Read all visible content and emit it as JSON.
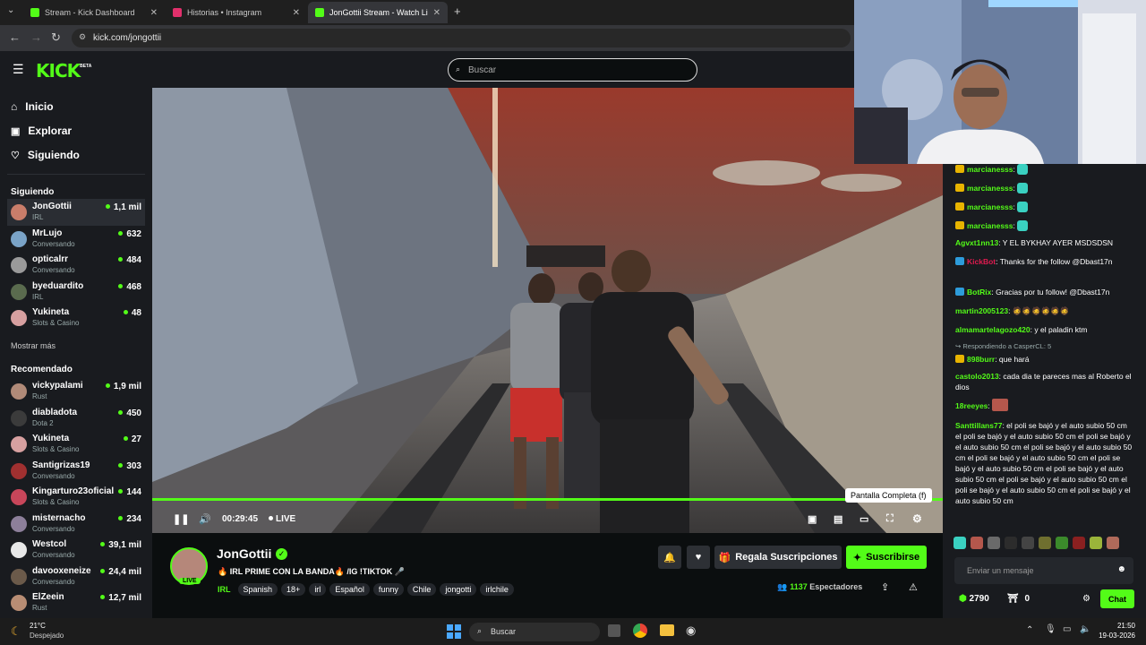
{
  "browser": {
    "tabs": [
      {
        "title": "Stream - Kick Dashboard",
        "color": "#53fc18"
      },
      {
        "title": "Historias • Instagram",
        "color": "#e1306c"
      },
      {
        "title": "JonGottii Stream - Watch Li",
        "color": "#53fc18"
      }
    ],
    "url": "kick.com/jongottii"
  },
  "header": {
    "logo": "KICK",
    "logo_badge": "BETA",
    "search_placeholder": "Buscar"
  },
  "sidebar": {
    "nav": [
      {
        "label": "Inicio",
        "icon": "home-icon"
      },
      {
        "label": "Explorar",
        "icon": "compass-icon"
      },
      {
        "label": "Siguiendo",
        "icon": "heart-icon"
      }
    ],
    "following_title": "Siguiendo",
    "following": [
      {
        "name": "JonGottii",
        "category": "IRL",
        "viewers": "1,1 mil",
        "color": "#c97d6a"
      },
      {
        "name": "MrLujo",
        "category": "Conversando",
        "viewers": "632",
        "color": "#7aa3c7"
      },
      {
        "name": "opticalrr",
        "category": "Conversando",
        "viewers": "484",
        "color": "#9a9a9a"
      },
      {
        "name": "byeduardito",
        "category": "IRL",
        "viewers": "468",
        "color": "#5a6b4e"
      },
      {
        "name": "Yukineta",
        "category": "Slots & Casino",
        "viewers": "48",
        "color": "#d7a0a0"
      }
    ],
    "show_more": "Mostrar más",
    "recommended_title": "Recomendado",
    "recommended": [
      {
        "name": "vickypalami",
        "category": "Rust",
        "viewers": "1,9 mil",
        "color": "#b08a78"
      },
      {
        "name": "diabladota",
        "category": "Dota 2",
        "viewers": "450",
        "color": "#3b3b3b"
      },
      {
        "name": "Yukineta",
        "category": "Slots & Casino",
        "viewers": "27",
        "color": "#d7a0a0"
      },
      {
        "name": "Santigrizas19",
        "category": "Conversando",
        "viewers": "303",
        "color": "#a03030"
      },
      {
        "name": "Kingarturo23oficial",
        "category": "Slots & Casino",
        "viewers": "144",
        "color": "#c8465a"
      },
      {
        "name": "misternacho",
        "category": "Conversando",
        "viewers": "234",
        "color": "#8d7f9a"
      },
      {
        "name": "Westcol",
        "category": "Conversando",
        "viewers": "39,1 mil",
        "color": "#e8e8e8"
      },
      {
        "name": "davooxeneize",
        "category": "Conversando",
        "viewers": "24,4 mil",
        "color": "#6b5a4a"
      },
      {
        "name": "ElZeein",
        "category": "Rust",
        "viewers": "12,7 mil",
        "color": "#b88d74"
      }
    ]
  },
  "player": {
    "time": "00:29:45",
    "live": "LIVE",
    "tooltip": "Pantalla Completa (f)",
    "progress": 1.0
  },
  "stream": {
    "streamer": "JonGottii",
    "live_badge": "LIVE",
    "title": "🔥 IRL PRIME CON LA BANDA🔥 /IG !TIKTOK 🎤",
    "category": "IRL",
    "tags": [
      "Spanish",
      "18+",
      "irl",
      "Español",
      "funny",
      "Chile",
      "jongotti",
      "irlchile"
    ],
    "gift_label": "Regala Suscripciones",
    "subscribe_label": "Suscribirse",
    "viewers": "1137",
    "viewers_label": "Espectadores"
  },
  "chat": {
    "messages": [
      {
        "user": "marcianesss",
        "text": "",
        "color": "#53fc18",
        "badge": "#e8b400"
      },
      {
        "user": "marcianesss",
        "text": "",
        "color": "#53fc18",
        "badge": "#e8b400"
      },
      {
        "user": "marcianesss",
        "text": "",
        "color": "#53fc18",
        "badge": "#e8b400"
      },
      {
        "user": "marcianesss",
        "text": "",
        "color": "#53fc18",
        "badge": "#e8b400"
      },
      {
        "user": "Agvxt1nn13",
        "text": "Y EL BYKHAY AYER MSDSDSN",
        "color": "#53fc18",
        "badge": ""
      },
      {
        "user": "KickBot",
        "text": "Thanks for the follow @Dbast17n",
        "color": "#e01a4f",
        "badge": "#2d9cdb"
      },
      {
        "user": "BotRix",
        "text": "Gracias por tu follow! @Dbast17n",
        "color": "#53fc18",
        "badge": "#2d9cdb"
      },
      {
        "user": "martin2005123",
        "text": "🧔🧔🧔🧔🧔🧔",
        "color": "#53fc18",
        "badge": ""
      },
      {
        "user": "almamartelagozo420",
        "text": "y el paladin ktm",
        "color": "#53fc18",
        "badge": ""
      },
      {
        "user": "898burr",
        "text": "que hará",
        "color": "#53fc18",
        "badge": "#e8b400",
        "reply": "Respondiendo a CasperCL: 5"
      },
      {
        "user": "castolo2013",
        "text": "cada dia te pareces mas al Roberto el dios",
        "color": "#53fc18",
        "badge": ""
      },
      {
        "user": "18reeyes",
        "text": "",
        "color": "#53fc18",
        "badge": ""
      },
      {
        "user": "Santtillans77",
        "text": "el poli se bajó y el auto subio 50 cm el poli se bajó y el auto subio 50 cm el poli se bajó y el auto subio 50 cm el poli se bajó y el auto subio 50 cm el poli se bajó y el auto subio 50 cm el poli se bajó y el auto subio 50 cm el poli se bajó y el auto subio 50 cm el poli se bajó y el auto subio 50 cm el poli se bajó y el auto subio 50 cm el poli se bajó y el auto subio 50 cm",
        "color": "#53fc18",
        "badge": ""
      }
    ],
    "input_placeholder": "Enviar un mensaje",
    "points": "2790",
    "gift_count": "0",
    "chat_button": "Chat"
  },
  "taskbar": {
    "weather_temp": "21°C",
    "weather_desc": "Despejado",
    "search": "Buscar",
    "time": "21:50",
    "date": "19-03-2026"
  }
}
